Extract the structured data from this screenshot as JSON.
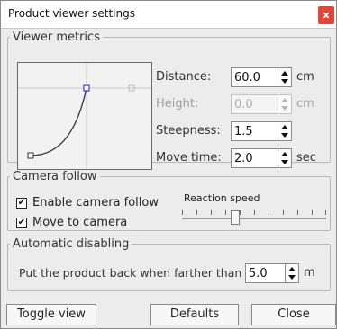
{
  "window": {
    "title": "Product viewer settings",
    "close_label": "x"
  },
  "viewer_metrics": {
    "legend": "Viewer metrics",
    "distance": {
      "label": "Distance:",
      "value": "60.0",
      "unit": "cm"
    },
    "height": {
      "label": "Height:",
      "value": "0.0",
      "unit": "cm"
    },
    "steepness": {
      "label": "Steepness:",
      "value": "1.5"
    },
    "move_time": {
      "label": "Move time:",
      "value": "2.0",
      "unit": "sec"
    }
  },
  "camera_follow": {
    "legend": "Camera follow",
    "enable": {
      "label": "Enable camera follow",
      "checked": true,
      "mark": "✔"
    },
    "move_to_camera": {
      "label": "Move to camera",
      "checked": true,
      "mark": "✔"
    },
    "reaction_speed": {
      "label": "Reaction speed",
      "value_fraction": 0.36
    }
  },
  "automatic_disabling": {
    "legend": "Automatic disabling",
    "label": "Put the product back when farther than",
    "value": "5.0",
    "unit": "m"
  },
  "buttons": {
    "toggle_view": "Toggle view",
    "defaults": "Defaults",
    "close": "Close"
  },
  "colors": {
    "close_button": "#e0473c",
    "curve_handle": "#3a3adb"
  }
}
